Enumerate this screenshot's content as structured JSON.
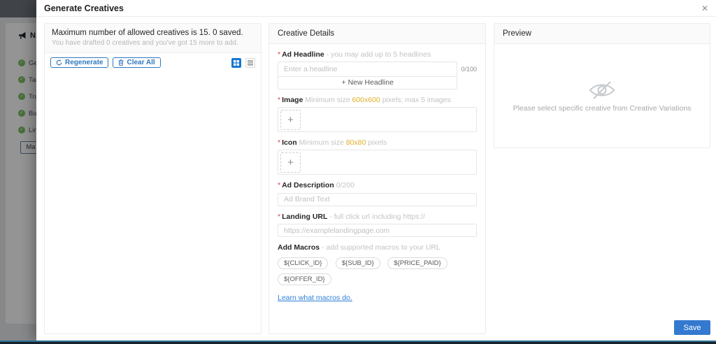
{
  "background": {
    "brand_fragment": "N",
    "check_glyph": "✓",
    "steps": [
      "Gen",
      "Tar",
      "Tra",
      "Bud",
      "Lin"
    ],
    "button_fragment": "Ma"
  },
  "modal": {
    "title": "Generate Creatives",
    "close_icon": "✕",
    "creatives_panel": {
      "info_title": "Maximum number of allowed creatives is 15. 0 saved.",
      "info_subtitle": "You have drafted 0 creatives and you've got 15 more to add.",
      "regenerate_label": "Regenerate",
      "clear_all_label": "Clear All"
    },
    "details_panel": {
      "title": "Creative Details",
      "required_marker": "*",
      "upload_plus": "+",
      "headline": {
        "label": "Ad Headline",
        "hint": "- you may add up to 5 headlines",
        "placeholder": "Enter a headline",
        "counter": "0/100",
        "add_glyph": "+",
        "new_headline_label": "New Headline"
      },
      "image": {
        "label": "Image",
        "hint_prefix": "Minimum size",
        "size": "600x600",
        "hint_suffix": "pixels; max 5 images"
      },
      "icon": {
        "label": "Icon",
        "hint_prefix": "Minimum size",
        "size": "80x80",
        "hint_suffix": "pixels"
      },
      "description": {
        "label": "Ad Description",
        "counter": "0/200",
        "placeholder": "Ad Brand Text"
      },
      "landing_url": {
        "label": "Landing URL",
        "hint": "- full click url including https://",
        "placeholder": "https://examplelandingpage.com"
      },
      "macros": {
        "label": "Add Macros",
        "hint": "- add supported macros to your URL",
        "chips": [
          "${CLICK_ID}",
          "${SUB_ID}",
          "${PRICE_PAID}",
          "${OFFER_ID}"
        ],
        "link": "Learn what macros do."
      }
    },
    "preview_panel": {
      "title": "Preview",
      "empty_text": "Please select specific creative from Creative Variations"
    },
    "save_label": "Save"
  },
  "colors": {
    "accent_blue": "#3379cf",
    "outline_blue": "#3178be",
    "warning_yellow": "#dfaf28",
    "link_blue": "#2f80d9",
    "success_green": "#7cbf63",
    "required_red": "#e23b41"
  }
}
